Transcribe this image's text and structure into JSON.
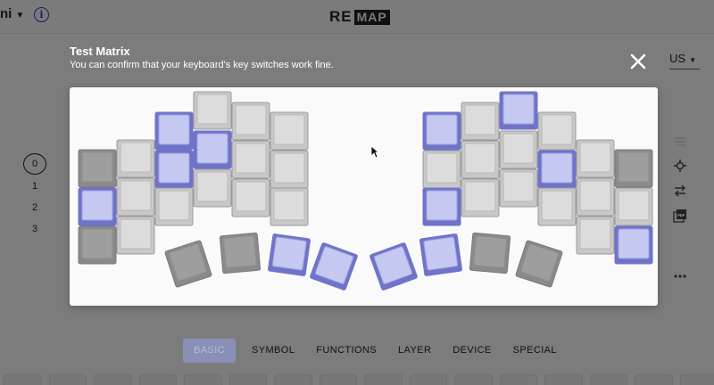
{
  "header": {
    "keyboard_name": "ni",
    "logo_prefix": "RE",
    "logo_suffix": "MAP"
  },
  "dialog": {
    "title": "Test Matrix",
    "subtitle": "You can confirm that your keyboard's key switches work fine.",
    "language": "US"
  },
  "layers": [
    "0",
    "1",
    "2",
    "3"
  ],
  "tabs": [
    "BASIC",
    "SYMBOL",
    "FUNCTIONS",
    "LAYER",
    "DEVICE",
    "SPECIAL"
  ],
  "colors": {
    "background": "#7c7c7c",
    "panel": "#fafafa",
    "key_off_fill": "#dcdcdc",
    "key_off_border": "#9a9a9a",
    "key_dark_fill": "#9e9e9e",
    "key_on_fill": "#c5c8f0",
    "key_on_border": "#6f74c9",
    "accent": "#1a1e6a"
  },
  "icons": {
    "info": "info-icon",
    "close": "close-icon",
    "layout_tools": [
      "list-icon",
      "crosshair-icon",
      "swap-icon",
      "pdf-icon",
      "more-icon"
    ]
  },
  "matrix": {
    "key_states": {
      "pressed": "on",
      "released": "off",
      "dark": "dark"
    }
  }
}
